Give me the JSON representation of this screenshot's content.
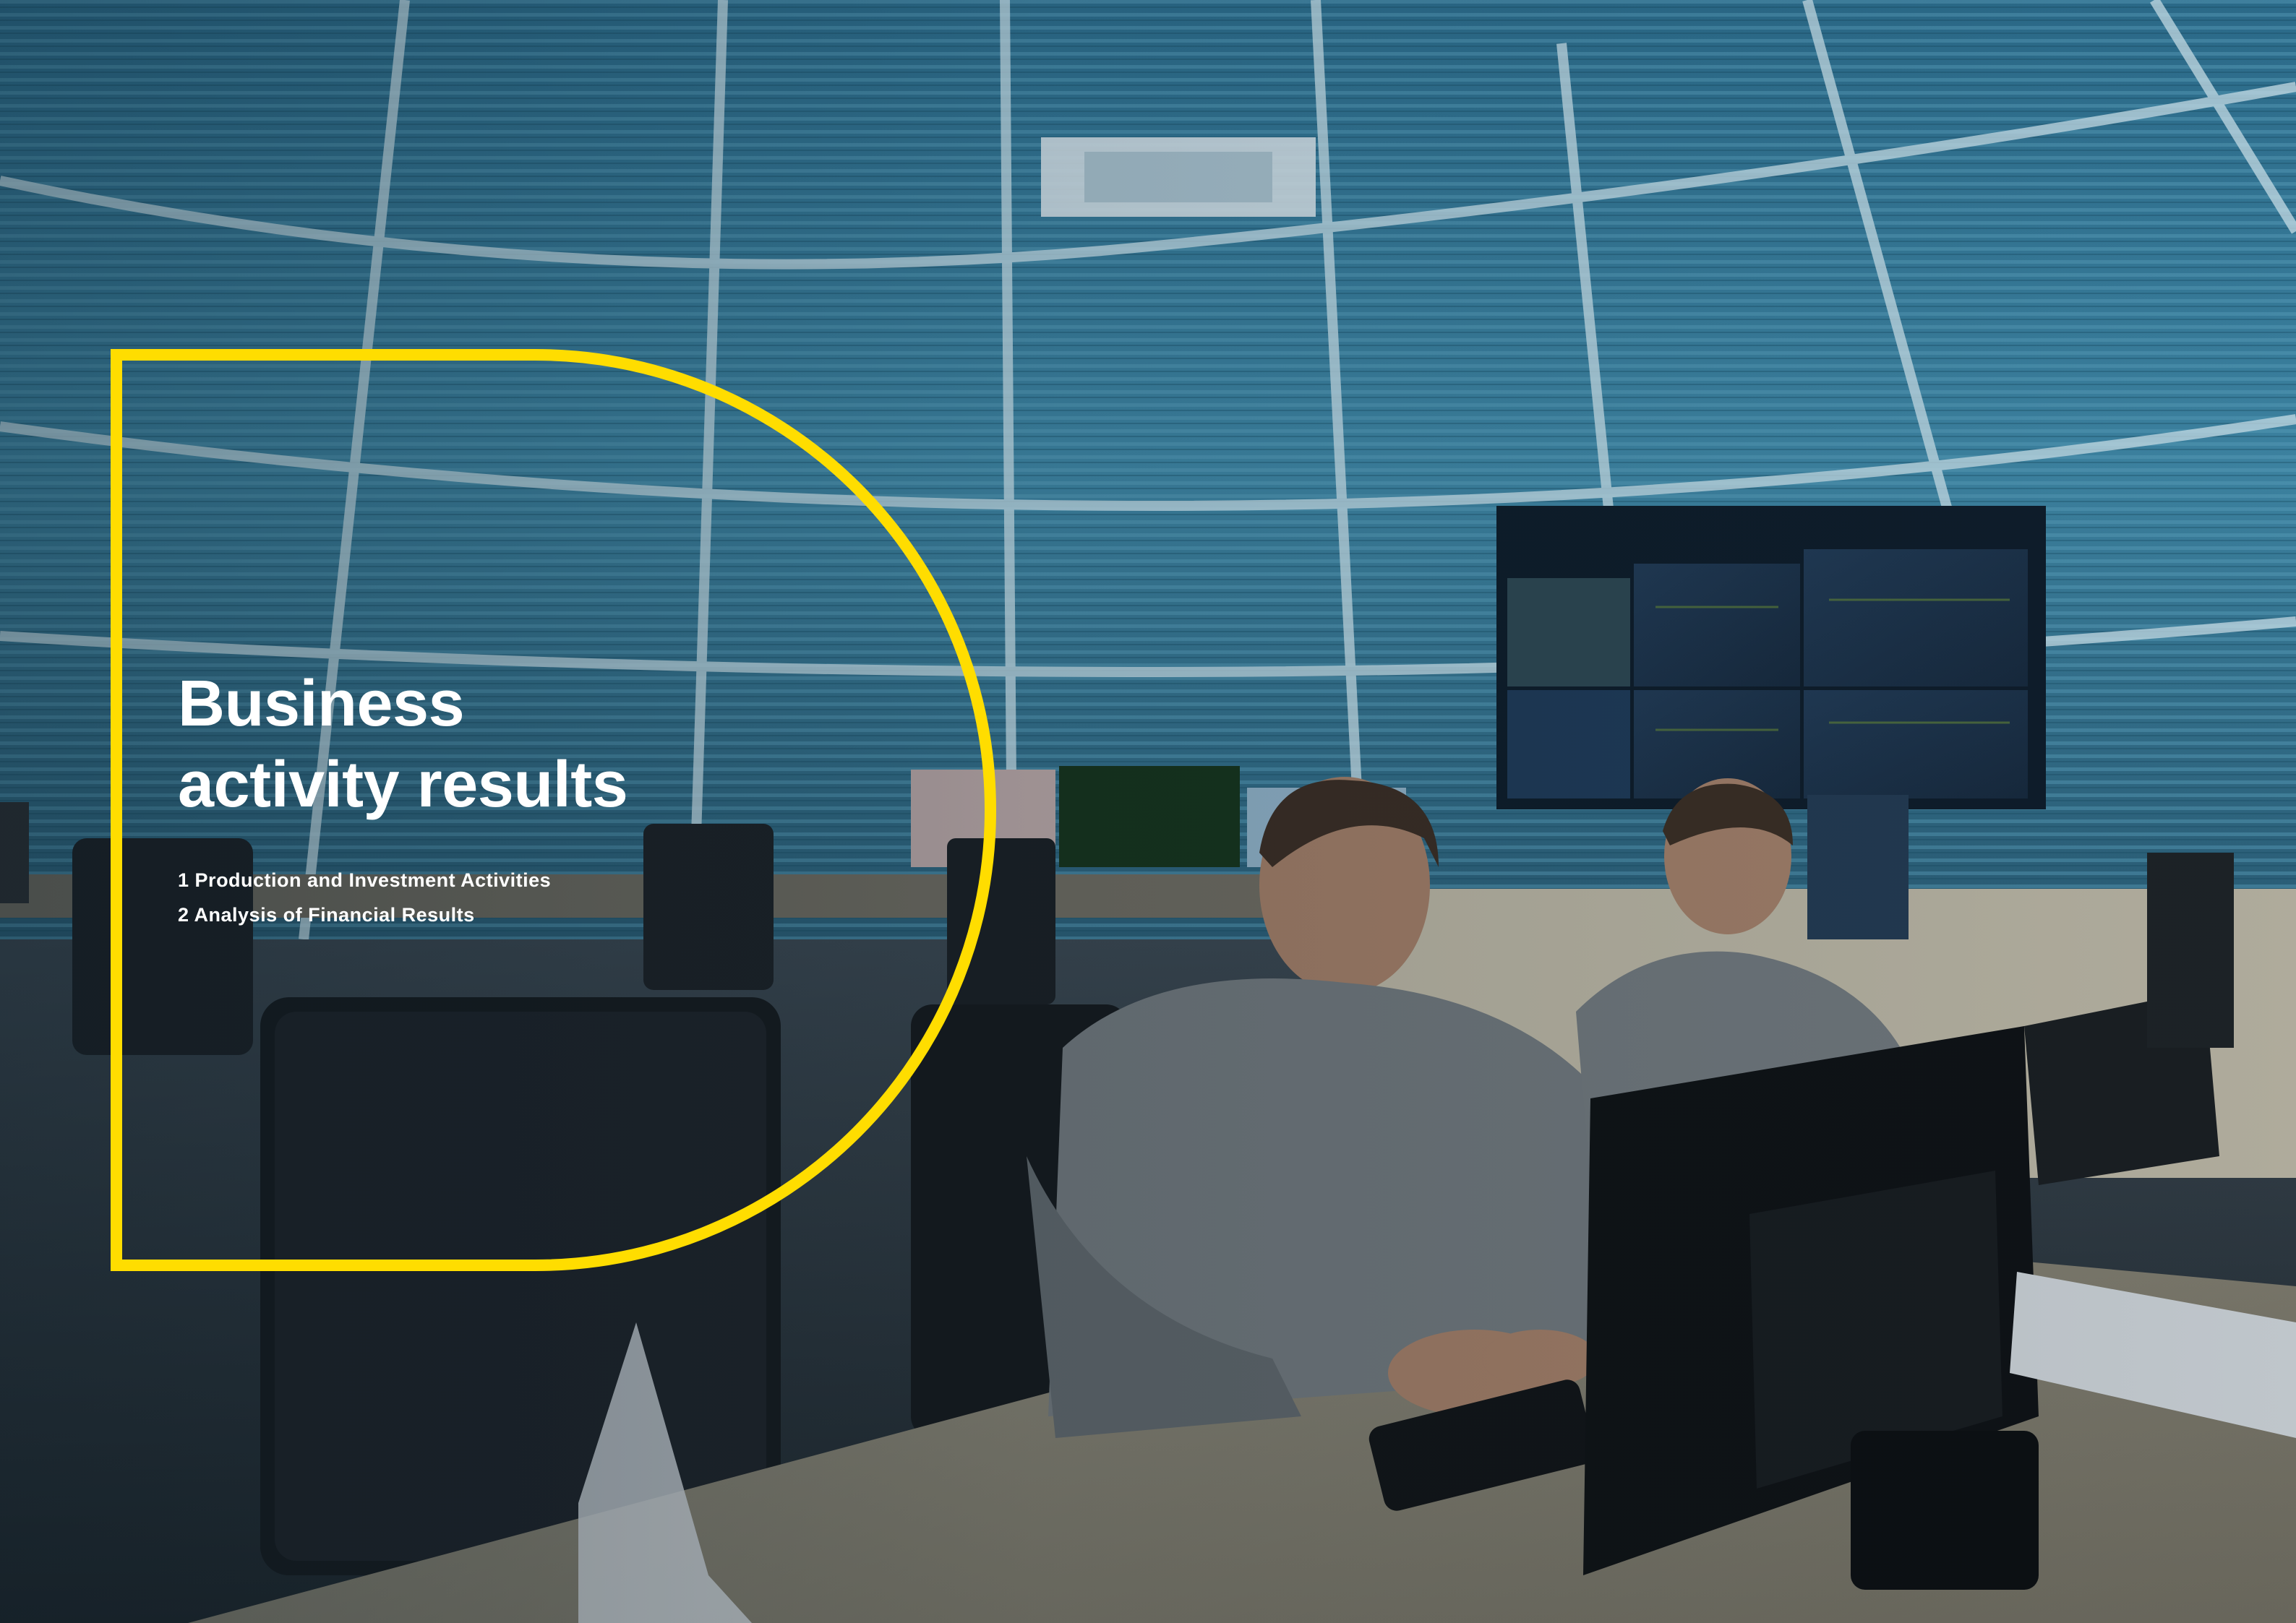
{
  "section": {
    "title_line1": "Business",
    "title_line2": "activity results"
  },
  "toc": [
    {
      "number": "1",
      "label": "Production and Investment Activities"
    },
    {
      "number": "2",
      "label": "Analysis of Financial Results"
    }
  ],
  "colors": {
    "accent_yellow": "#FFDD00",
    "title_text": "#FFFFFF",
    "background_blue": "#2f6f8c"
  },
  "image": {
    "subject": "control-room-photo"
  }
}
